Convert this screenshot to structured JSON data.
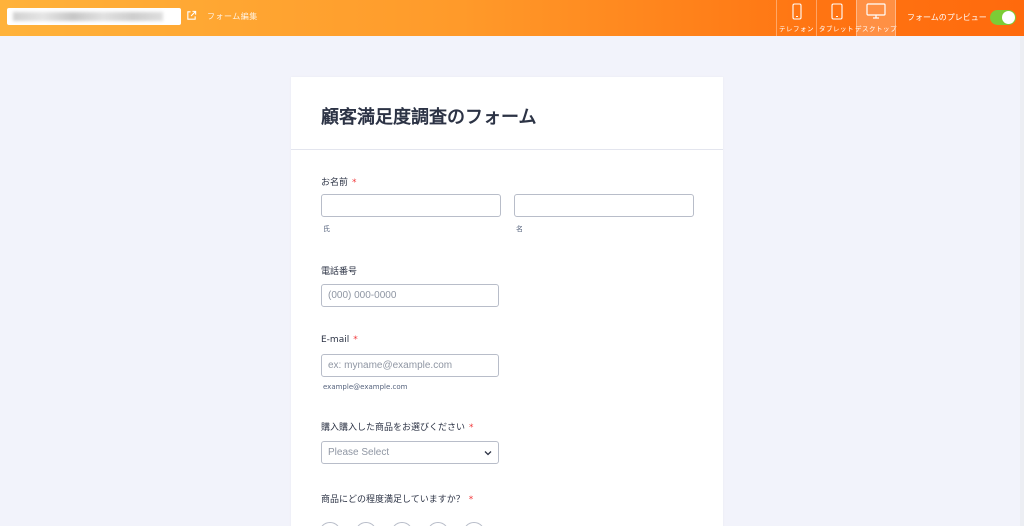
{
  "topbar": {
    "edit_link": "フォーム編集",
    "devices": [
      {
        "label": "テレフォン",
        "icon": "phone-icon",
        "active": false
      },
      {
        "label": "タブレット",
        "icon": "tablet-icon",
        "active": false
      },
      {
        "label": "デスクトップ",
        "icon": "desktop-icon",
        "active": true
      }
    ],
    "preview_label": "フォームのプレビュー",
    "preview_on": true
  },
  "colors": {
    "accent_start": "#ffb23a",
    "accent_end": "#ff6a0d",
    "required": "#f23a3c",
    "toggle_on": "#7ccd36",
    "page_bg": "#f2f3fb"
  },
  "form": {
    "title": "顧客満足度調査のフォーム",
    "name": {
      "label": "お名前",
      "required": "*",
      "first_value": "",
      "last_value": "",
      "first_sublabel": "氏",
      "last_sublabel": "名"
    },
    "phone": {
      "label": "電話番号",
      "placeholder": "(000) 000-0000"
    },
    "email": {
      "label": "E-mail",
      "required": "*",
      "placeholder": "ex: myname@example.com",
      "sublabel": "example@example.com"
    },
    "product": {
      "label": "購入購入した商品をお選びください",
      "required": "*",
      "selected": "Please Select"
    },
    "satisfaction": {
      "label": "商品にどの程度満足していますか？",
      "required": "*"
    }
  }
}
